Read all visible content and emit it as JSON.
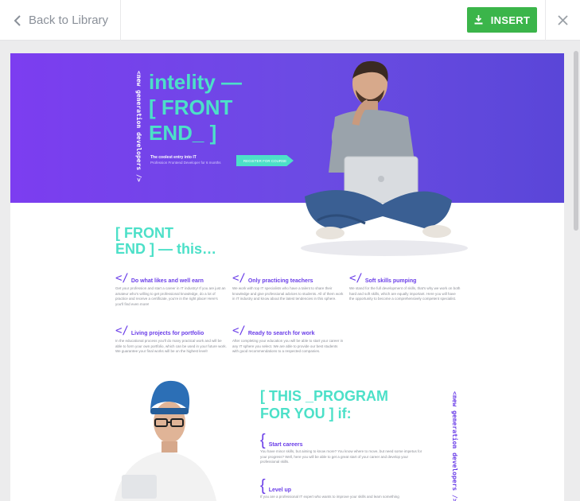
{
  "toolbar": {
    "back_label": "Back to Library",
    "insert_label": "INSERT"
  },
  "hero": {
    "vertical_text_1": "<new generation developers />",
    "brand_line1": "intelity —",
    "brand_line2": "[ FRONT",
    "brand_line3": "END_ ]",
    "subtitle": "The coolest entry into IT",
    "subtitle2": "Profession Frontend Developer for 6 months",
    "cta": "REGISTER FOR COURSE"
  },
  "section": {
    "title_line1": "[ FRONT",
    "title_line2": "END ] — this…",
    "features": [
      {
        "title": "Do what likes and well earn",
        "desc": "Get your profession and start a career in IT industry! If you are just an amateur who's willing to get professional knowledge, do a lot of practice and receive a certificate, you're in the right place! Here's you'll find even more!"
      },
      {
        "title": "Only practicing teachers",
        "desc": "We work with top IT specialists who have a talent to share their knowledge and give professional advices to students. All of them work in IT industry and know about the latest tendencies in this sphere."
      },
      {
        "title": "Soft skills pumping",
        "desc": "We stand for the full development of skills, that's why we work on both hard and soft skills, which are equally important. Here you will have the opportunity to become a comprehensively competent specialist."
      },
      {
        "title": "Living projects for portfolio",
        "desc": "In the educational process you'll do many practical work and will be able to form your own portfolio, which can be used in your future work. We guarantee your final works will be on the highest level!"
      },
      {
        "title": "Ready to search for work",
        "desc": "After completing your education you will be able to start your career in any IT sphere you select. We are able to provide our best students with good recommendations to a respected companies."
      }
    ]
  },
  "program": {
    "title_line1": "[ THIS _PROGRAM",
    "title_line2": "FOR YOU ] if:",
    "vertical_text": "<new generation developers />",
    "items": [
      {
        "title": "Start careers",
        "desc": "You have minor skills, but aiming to know more? You know where to move, but need some impetus for your progress? Well, here you will be able to get a great start of your career and develop your professional skills."
      },
      {
        "title": "Level up",
        "desc": "If you are a professional IT expert who wants to improve your skills and learn something"
      }
    ]
  },
  "icons": {
    "back": "chevron-left-icon",
    "insert": "download-icon",
    "close": "close-icon"
  },
  "colors": {
    "accent_green": "#3bb54a",
    "hero_purple": "#7c3df0",
    "teal": "#4ce0c8",
    "violet_text": "#6a3de8"
  }
}
